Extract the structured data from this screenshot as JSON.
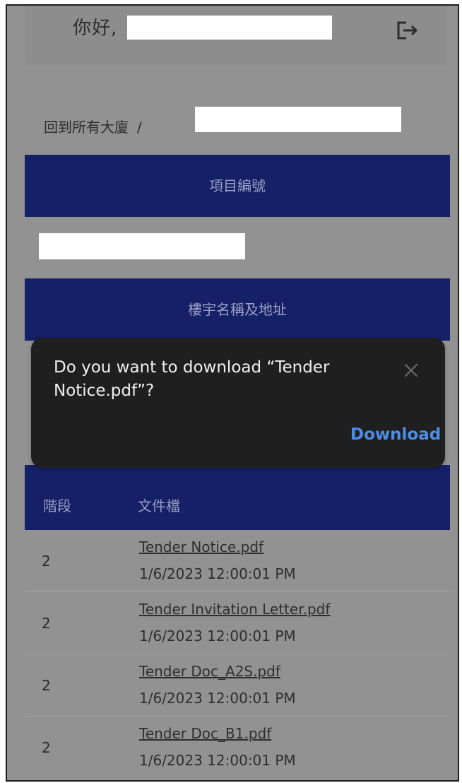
{
  "header": {
    "greeting": "你好,",
    "logout_icon": "logout-icon"
  },
  "breadcrumb": {
    "back_link": "回到所有大廈",
    "separator": "/"
  },
  "sections": {
    "project_number_label": "項目編號",
    "building_label": "樓宇名稱及地址"
  },
  "table": {
    "columns": [
      "階段",
      "文件檔"
    ],
    "rows": [
      {
        "stage": "2",
        "file": "Tender Notice.pdf",
        "date": "1/6/2023 12:00:01 PM"
      },
      {
        "stage": "2",
        "file": "Tender Invitation Letter.pdf",
        "date": "1/6/2023 12:00:01 PM"
      },
      {
        "stage": "2",
        "file": "Tender Doc_A2S.pdf",
        "date": "1/6/2023 12:00:01 PM"
      },
      {
        "stage": "2",
        "file": "Tender Doc_B1.pdf",
        "date": "1/6/2023 12:00:01 PM"
      }
    ]
  },
  "download_dialog": {
    "message": "Do you want to download “Tender Notice.pdf”?",
    "download_label": "Download",
    "close_icon": "close-icon",
    "accent_color": "#4d8ee8"
  },
  "colors": {
    "band": "#152066",
    "dialog_bg": "#1f1f1f"
  }
}
